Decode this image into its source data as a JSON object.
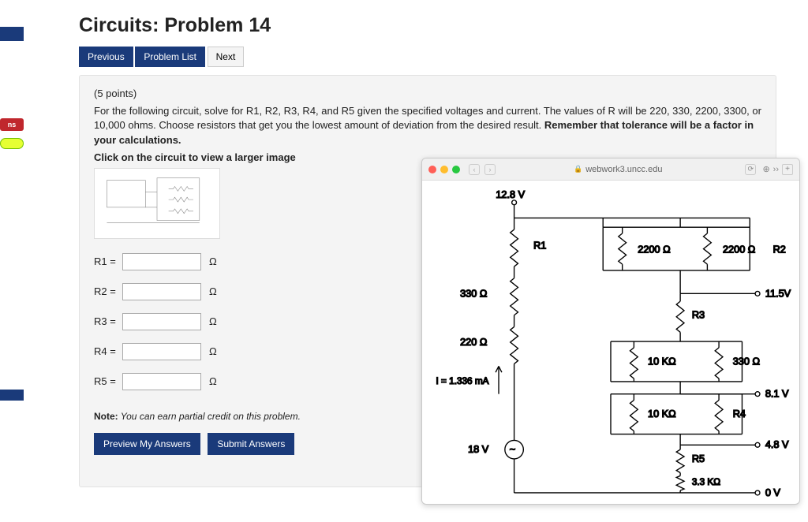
{
  "title": "Circuits: Problem 14",
  "nav": {
    "previous": "Previous",
    "problem_list": "Problem List",
    "next": "Next"
  },
  "sidebar": {
    "pill_label": "ns"
  },
  "problem": {
    "points": "(5 points)",
    "body": "For the following circuit, solve for R1, R2, R3, R4, and R5 given the specified voltages and current. The values of R will be 220, 330, 2200, 3300, or 10,000 ohms. Choose resistors that get you the lowest amount of deviation from the desired result. ",
    "body_bold": "Remember that tolerance will be a factor in your calculations.",
    "image_caption": "Click on the circuit to view a larger image",
    "unit": "Ω",
    "fields": [
      {
        "label": "R1 =",
        "value": ""
      },
      {
        "label": "R2 =",
        "value": ""
      },
      {
        "label": "R3 =",
        "value": ""
      },
      {
        "label": "R4 =",
        "value": ""
      },
      {
        "label": "R5 =",
        "value": ""
      }
    ],
    "note_prefix": "Note:",
    "note": " You can earn partial credit on this problem."
  },
  "actions": {
    "preview": "Preview My Answers",
    "submit": "Submit Answers"
  },
  "popup": {
    "host": "webwork3.uncc.edu",
    "labels": {
      "v_top": "12.8 V",
      "r1": "R1",
      "r2": "R2",
      "r3": "R3",
      "r4": "R4",
      "r5": "R5",
      "res_2200a": "2200 Ω",
      "res_2200b": "2200 Ω",
      "res_330l": "330 Ω",
      "res_220l": "220 Ω",
      "res_10k_a": "10 KΩ",
      "res_10k_b": "10 KΩ",
      "res_330r": "330 Ω",
      "res_3_3k": "3.3 KΩ",
      "v_11_5": "11.5V",
      "v_8_1": "8.1 V",
      "v_4_8": "4.8 V",
      "v_0": "0 V",
      "v_18": "18 V",
      "i_label": "I = 1.336 mA"
    }
  },
  "chart_data": {
    "type": "table",
    "circuit": {
      "source_voltage": "18 V",
      "known_resistors_ohm": [
        2200,
        2200,
        330,
        220,
        10000,
        10000,
        330,
        3300
      ],
      "unknown_resistors": [
        "R1",
        "R2",
        "R3",
        "R4",
        "R5"
      ],
      "allowed_values_ohm": [
        220,
        330,
        2200,
        3300,
        10000
      ],
      "node_voltages_V": {
        "top": 12.8,
        "a": 11.5,
        "b": 8.1,
        "c": 4.8,
        "ground": 0
      },
      "current_mA": 1.336
    }
  }
}
